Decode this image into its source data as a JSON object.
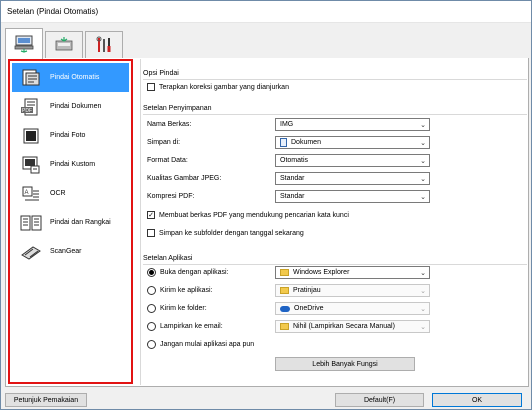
{
  "window": {
    "title": "Setelan (Pindai Otomatis)"
  },
  "tabs": [
    {
      "name": "scan-from-computer",
      "icon": "computer-scan-icon"
    },
    {
      "name": "scan-from-panel",
      "icon": "panel-scan-icon"
    },
    {
      "name": "general-settings",
      "icon": "tools-icon"
    }
  ],
  "sidebar": {
    "items": [
      {
        "label": "Pindai Otomatis",
        "icon": "auto-scan-icon"
      },
      {
        "label": "Pindai Dokumen",
        "icon": "pdf-document-icon"
      },
      {
        "label": "Pindai Foto",
        "icon": "photo-icon"
      },
      {
        "label": "Pindai Kustom",
        "icon": "custom-scan-icon"
      },
      {
        "label": "OCR",
        "icon": "ocr-icon"
      },
      {
        "label": "Pindai dan Rangkai",
        "icon": "stitch-icon"
      },
      {
        "label": "ScanGear",
        "icon": "scangear-icon"
      }
    ]
  },
  "scan_options": {
    "title": "Opsi Pindai",
    "apply_correction": "Terapkan koreksi gambar yang dianjurkan"
  },
  "save_settings": {
    "title": "Setelan Penyimpanan",
    "file_name_label": "Nama Berkas:",
    "file_name_value": "IMG",
    "save_in_label": "Simpan di:",
    "save_in_value": "Dokumen",
    "data_format_label": "Format Data:",
    "data_format_value": "Otomatis",
    "jpeg_quality_label": "Kualitas Gambar JPEG:",
    "jpeg_quality_value": "Standar",
    "pdf_compression_label": "Kompresi PDF:",
    "pdf_compression_value": "Standar",
    "keyword_pdf": "Membuat berkas PDF yang mendukung pencarian kata kunci",
    "subfolder_date": "Simpan ke subfolder dengan tanggal sekarang"
  },
  "app_settings": {
    "title": "Setelan Aplikasi",
    "open_with_label": "Buka dengan aplikasi:",
    "open_with_value": "Windows Explorer",
    "send_to_app_label": "Kirim ke aplikasi:",
    "send_to_app_value": "Pratinjau",
    "send_to_folder_label": "Kirim ke folder:",
    "send_to_folder_value": "OneDrive",
    "attach_email_label": "Lampirkan ke email:",
    "attach_email_value": "Nihil (Lampirkan Secara Manual)",
    "no_app_label": "Jangan mulai aplikasi apa pun",
    "more_functions": "Lebih Banyak Fungsi"
  },
  "footer": {
    "instructions": "Petunjuk Pemakaian",
    "defaults": "Default(F)",
    "ok": "OK"
  }
}
